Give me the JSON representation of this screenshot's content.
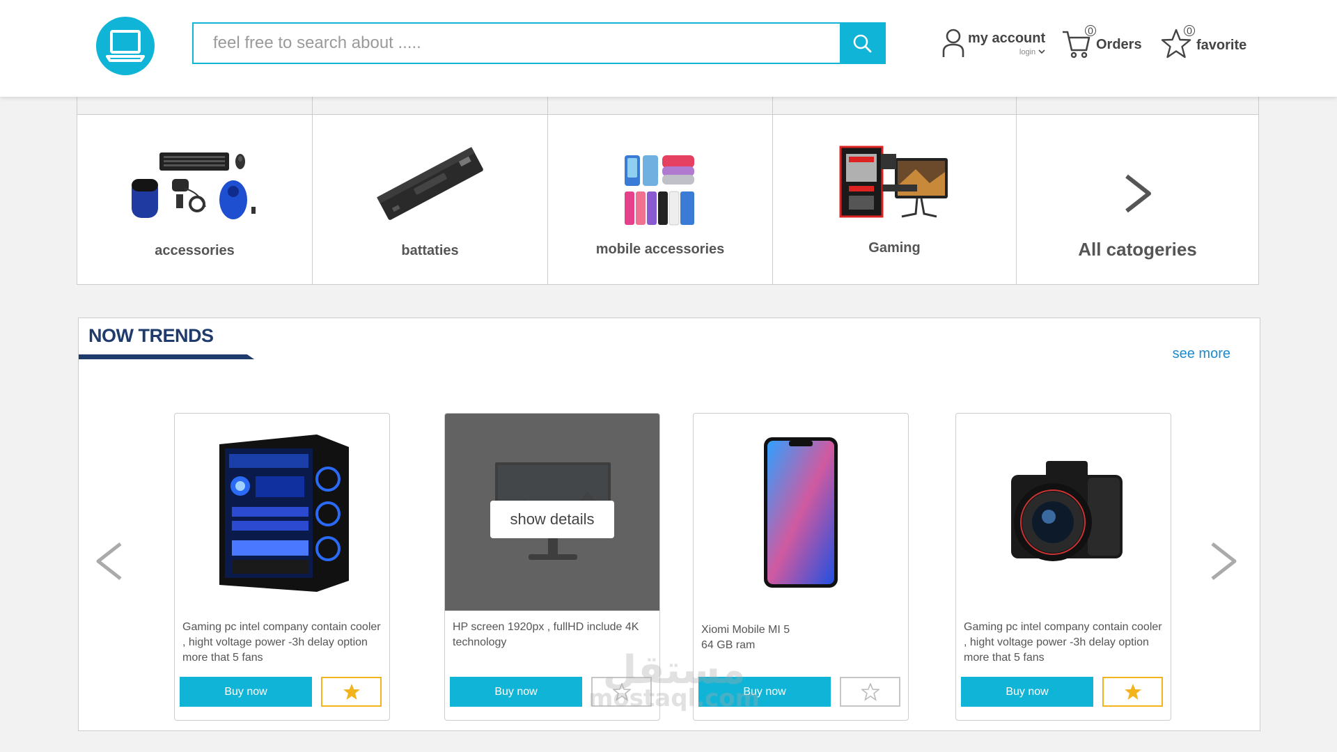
{
  "header": {
    "search_placeholder": "feel free to search about .....",
    "account_label": "my account",
    "account_sub": "login",
    "orders_label": "Orders",
    "orders_count": "0",
    "favorite_label": "favorite",
    "favorite_count": "0"
  },
  "categories": [
    {
      "label": "accessories",
      "icon": "accessories-icon"
    },
    {
      "label": "battaties",
      "icon": "battery-icon"
    },
    {
      "label": "mobile accessories",
      "icon": "phone-cases-icon"
    },
    {
      "label": "Gaming",
      "icon": "gaming-pc-icon"
    },
    {
      "label": "All catogeries",
      "icon": "chevron-right-icon"
    }
  ],
  "trends": {
    "title": "NOW TRENDS",
    "see_more": "see more",
    "products": [
      {
        "desc": "Gaming pc intel company contain cooler , hight voltage power -3h delay option more that 5 fans",
        "buy": "Buy now",
        "favorite": true
      },
      {
        "desc": "HP screen 1920px , fullHD include 4K technology",
        "buy": "Buy now",
        "favorite": false,
        "overlay": "show details"
      },
      {
        "desc": "Xiomi Mobile MI 5\n64 GB ram",
        "buy": "Buy now",
        "favorite": false
      },
      {
        "desc": "Gaming pc intel company contain cooler , hight voltage power -3h delay option more that 5 fans",
        "buy": "Buy now",
        "favorite": true
      }
    ]
  },
  "watermark": {
    "line1": "مستقل",
    "line2": "mostaql.com"
  },
  "colors": {
    "accent": "#10b4d6",
    "title": "#1f3b6b",
    "link": "#1a8bd0",
    "star": "#f3b31c"
  }
}
